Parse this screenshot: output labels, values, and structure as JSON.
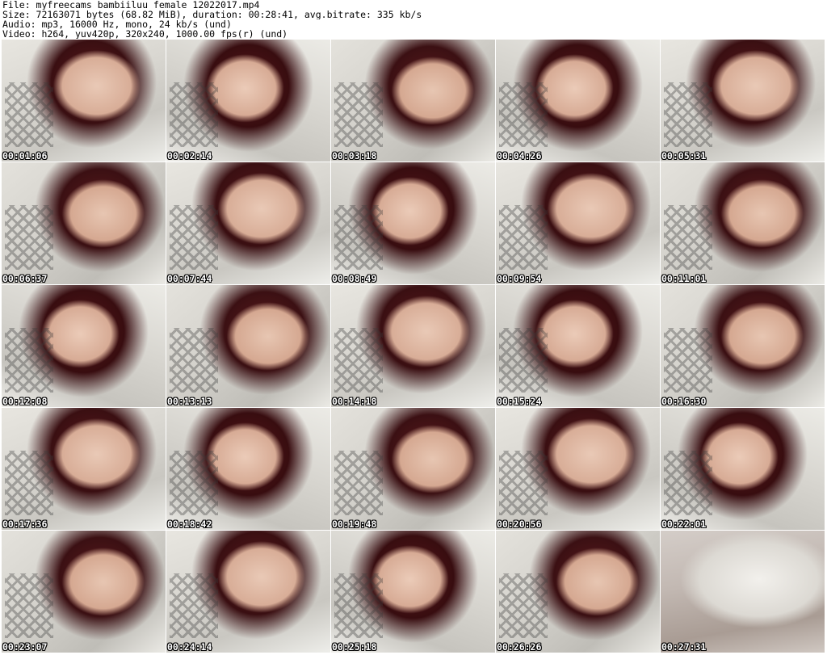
{
  "header": {
    "file_line": "File: myfreecams_bambiiluu_female_12022017.mp4",
    "size_line": "Size: 72163071 bytes (68.82 MiB), duration: 00:28:41, avg.bitrate: 335 kb/s",
    "audio_line": "Audio: mp3, 16000 Hz, mono, 24 kb/s (und)",
    "video_line": "Video: h264, yuv420p, 320x240, 1000.00 fps(r) (und)"
  },
  "frames": [
    {
      "timestamp": "00:01:06"
    },
    {
      "timestamp": "00:02:14"
    },
    {
      "timestamp": "00:03:18"
    },
    {
      "timestamp": "00:04:26"
    },
    {
      "timestamp": "00:05:31"
    },
    {
      "timestamp": "00:06:37"
    },
    {
      "timestamp": "00:07:44"
    },
    {
      "timestamp": "00:08:49"
    },
    {
      "timestamp": "00:09:54"
    },
    {
      "timestamp": "00:11:01"
    },
    {
      "timestamp": "00:12:08"
    },
    {
      "timestamp": "00:13:13"
    },
    {
      "timestamp": "00:14:18"
    },
    {
      "timestamp": "00:15:24"
    },
    {
      "timestamp": "00:16:30"
    },
    {
      "timestamp": "00:17:36"
    },
    {
      "timestamp": "00:18:42"
    },
    {
      "timestamp": "00:19:48"
    },
    {
      "timestamp": "00:20:56"
    },
    {
      "timestamp": "00:22:01"
    },
    {
      "timestamp": "00:23:07"
    },
    {
      "timestamp": "00:24:14"
    },
    {
      "timestamp": "00:25:18"
    },
    {
      "timestamp": "00:26:26"
    },
    {
      "timestamp": "00:27:31"
    }
  ]
}
